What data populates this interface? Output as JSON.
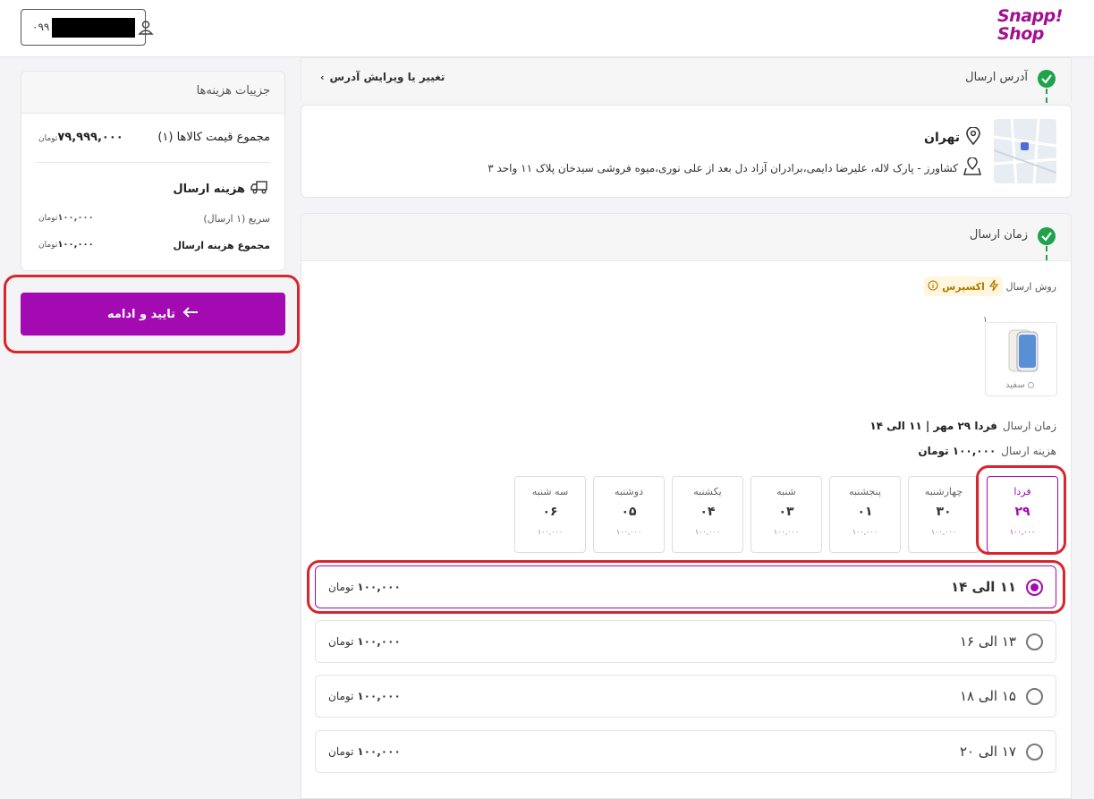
{
  "header": {
    "logo_line1": "Snapp!",
    "logo_line2": "Shop",
    "phone_prefix": "۰۹۹"
  },
  "summary": {
    "title": "جزییات هزینه‌ها",
    "items_label": "مجموع قیمت کالاها (۱)",
    "items_value": "۷۹,۹۹۹,۰۰۰",
    "currency": "تومان",
    "shipping_title": "هزینه ارسال",
    "fast_label": "سریع (۱ ارسال)",
    "fast_value": "۱۰۰,۰۰۰",
    "shipping_total_label": "مجموع هزینه ارسال",
    "shipping_total_value": "۱۰۰,۰۰۰"
  },
  "confirm_button": "تایید و ادامه",
  "address": {
    "section_title": "آدرس ارسال",
    "change_link": "تغییر یا ویرایش آدرس",
    "city": "تهران",
    "full_address": "کشاورز - پارک لاله، علیرضا دایمی،برادران آزاد دل بعد از علی نوری،میوه فروشی سیدخان پلاک ۱۱ واحد ۳"
  },
  "delivery": {
    "section_title": "زمان ارسال",
    "method_label": "روش ارسال",
    "express_label": "اکسپرس",
    "product_qty": "۱",
    "product_color": "سفید",
    "time_label": "زمان ارسال",
    "time_value": "فردا ۲۹ مهر | ۱۱ الی ۱۴",
    "cost_label": "هزینه ارسال",
    "cost_value": "۱۰۰,۰۰۰ تومان",
    "days": [
      {
        "name": "فردا",
        "date": "۲۹",
        "price": "۱۰۰,۰۰۰"
      },
      {
        "name": "چهارشنبه",
        "date": "۳۰",
        "price": "۱۰۰,۰۰۰"
      },
      {
        "name": "پنجشنبه",
        "date": "۰۱",
        "price": "۱۰۰,۰۰۰"
      },
      {
        "name": "شنبه",
        "date": "۰۳",
        "price": "۱۰۰,۰۰۰"
      },
      {
        "name": "یکشنبه",
        "date": "۰۴",
        "price": "۱۰۰,۰۰۰"
      },
      {
        "name": "دوشنبه",
        "date": "۰۵",
        "price": "۱۰۰,۰۰۰"
      },
      {
        "name": "سه شنبه",
        "date": "۰۶",
        "price": "۱۰۰,۰۰۰"
      }
    ],
    "slots": [
      {
        "label": "۱۱ الی ۱۴",
        "price": "۱۰۰,۰۰۰",
        "currency": "تومان"
      },
      {
        "label": "۱۳ الی ۱۶",
        "price": "۱۰۰,۰۰۰",
        "currency": "تومان"
      },
      {
        "label": "۱۵ الی ۱۸",
        "price": "۱۰۰,۰۰۰",
        "currency": "تومان"
      },
      {
        "label": "۱۷ الی ۲۰",
        "price": "۱۰۰,۰۰۰",
        "currency": "تومان"
      }
    ]
  },
  "colors": {
    "brand": "#a40ab1",
    "success": "#1ea34a",
    "annotation": "#d8262e"
  }
}
